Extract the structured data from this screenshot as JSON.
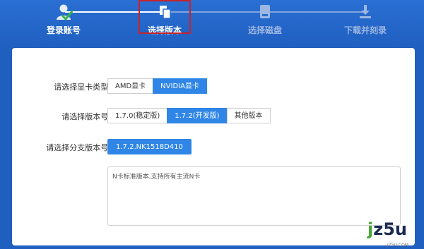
{
  "steps": [
    {
      "label": "登录账号",
      "icon": "user-check-icon",
      "state": "done"
    },
    {
      "label": "选择版本",
      "icon": "copy-icon",
      "state": "active"
    },
    {
      "label": "选择磁盘",
      "icon": "disk-icon",
      "state": "pending"
    },
    {
      "label": "下载并刻录",
      "icon": "download-icon",
      "state": "pending"
    }
  ],
  "form": {
    "gpu_type": {
      "label": "请选择显卡类型:",
      "options": [
        "AMD显卡",
        "NVIDIA显卡"
      ],
      "selected": "NVIDIA显卡"
    },
    "version": {
      "label": "请选择版本号:",
      "options": [
        "1.7.0(稳定版)",
        "1.7.2(开发版)",
        "其他版本"
      ],
      "selected": "1.7.2(开发版)"
    },
    "branch": {
      "label": "请选择分支版本号:",
      "value": "1.7.2.NK1518D410"
    },
    "description": "N卡标准版本,支持所有主流N卡"
  },
  "watermark": {
    "main_j": "j",
    "main_rest": "z5u",
    "sub": "JZ5U.COM"
  },
  "colors": {
    "header_bg": "#1f5fc0",
    "accent": "#2f86e6",
    "highlight_border": "#c8232a",
    "check_green": "#3cb34a"
  }
}
